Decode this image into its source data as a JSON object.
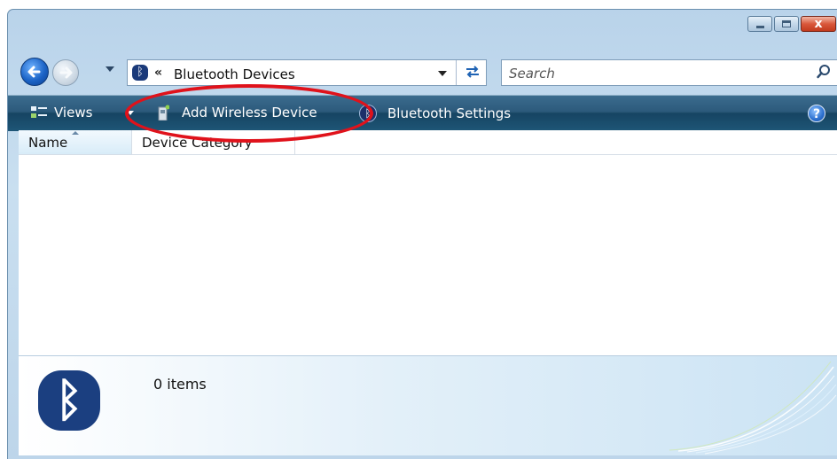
{
  "window": {
    "caption_buttons": [
      "minimize",
      "maximize",
      "close"
    ],
    "close_symbol": "x"
  },
  "navigation": {
    "address": {
      "icon": "bluetooth-icon",
      "chevron": "«",
      "path": "Bluetooth Devices"
    },
    "search": {
      "placeholder": "Search"
    }
  },
  "toolbar": {
    "views_label": "Views",
    "add_device_label": "Add Wireless Device",
    "bt_settings_label": "Bluetooth Settings",
    "help_symbol": "?"
  },
  "list": {
    "columns": [
      "Name",
      "Device Category"
    ],
    "sorted_by": "Name",
    "rows": []
  },
  "details": {
    "item_count": "0 items",
    "icon": "bluetooth-large-icon"
  },
  "annotation": {
    "color": "#e0121b",
    "target": "Add Wireless Device"
  },
  "colors": {
    "command_bar": "#1e5677",
    "window_frame": "#b9d3ea",
    "bluetooth_blue": "#1b3f80"
  }
}
